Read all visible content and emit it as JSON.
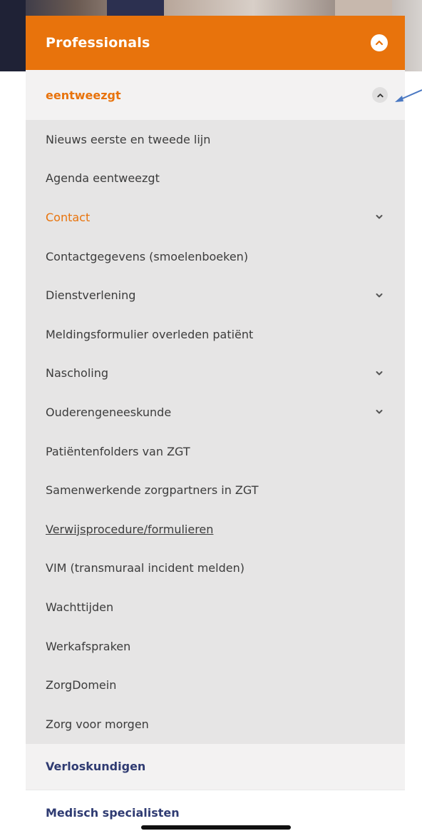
{
  "menu": {
    "header": {
      "title": "Professionals",
      "toggle_icon": "chevron-up-circle-icon"
    },
    "section": {
      "title": "eentweezgt",
      "toggle_icon": "chevron-up-icon"
    },
    "items": [
      {
        "label": "Nieuws eerste en tweede lijn",
        "expandable": false
      },
      {
        "label": "Agenda eentweezgt",
        "expandable": false
      },
      {
        "label": "Contact",
        "expandable": true,
        "active": true
      },
      {
        "label": "Contactgegevens (smoelenboeken)",
        "expandable": false
      },
      {
        "label": "Dienstverlening",
        "expandable": true
      },
      {
        "label": "Meldingsformulier overleden patiënt",
        "expandable": false
      },
      {
        "label": "Nascholing",
        "expandable": true
      },
      {
        "label": "Ouderengeneeskunde",
        "expandable": true
      },
      {
        "label": "Patiëntenfolders van ZGT",
        "expandable": false
      },
      {
        "label": "Samenwerkende zorgpartners in ZGT",
        "expandable": false
      },
      {
        "label": "Verwijsprocedure/formulieren",
        "expandable": false,
        "link": true
      },
      {
        "label": "VIM (transmuraal incident melden)",
        "expandable": false
      },
      {
        "label": "Wachttijden",
        "expandable": false
      },
      {
        "label": "Werkafspraken",
        "expandable": false
      },
      {
        "label": "ZorgDomein",
        "expandable": false
      },
      {
        "label": "Zorg voor morgen",
        "expandable": false
      }
    ],
    "bottom": [
      {
        "label": "Verloskundigen"
      },
      {
        "label": "Medisch specialisten"
      }
    ]
  },
  "colors": {
    "accent": "#e8730c",
    "navy": "#2f3b72",
    "submenu_bg": "#e6e5e5",
    "section_bg": "#f3f2f2"
  }
}
